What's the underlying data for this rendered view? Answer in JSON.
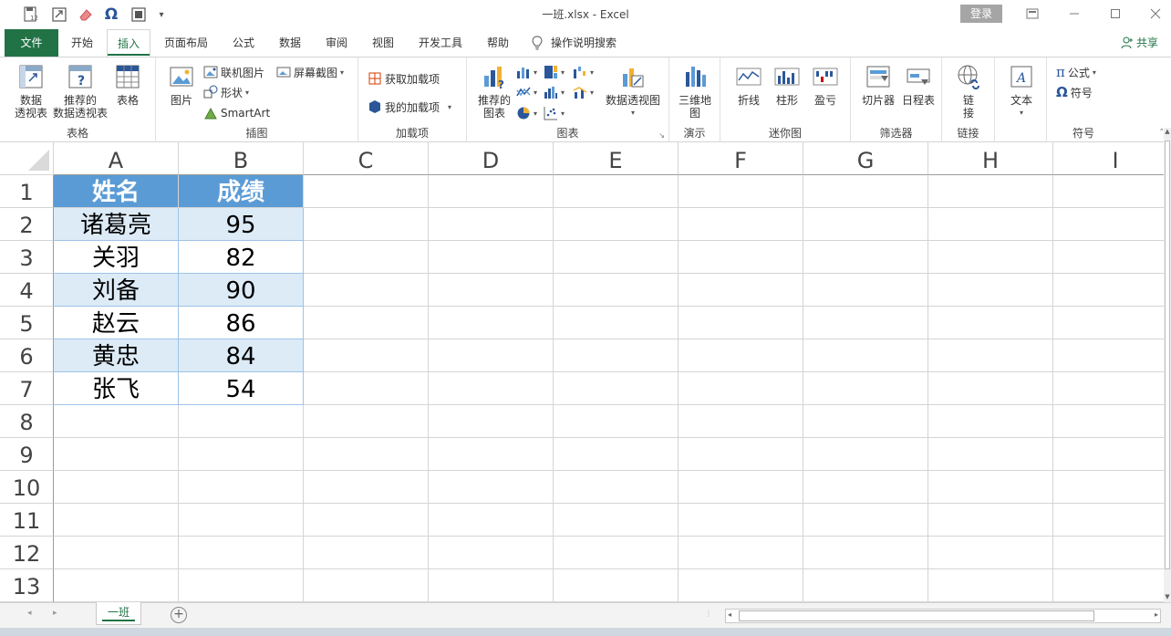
{
  "window": {
    "title": "一班.xlsx  -  Excel",
    "login_label": "登录"
  },
  "tabs": [
    {
      "label": "文件"
    },
    {
      "label": "开始"
    },
    {
      "label": "插入"
    },
    {
      "label": "页面布局"
    },
    {
      "label": "公式"
    },
    {
      "label": "数据"
    },
    {
      "label": "审阅"
    },
    {
      "label": "视图"
    },
    {
      "label": "开发工具"
    },
    {
      "label": "帮助"
    },
    {
      "label": "操作说明搜索"
    }
  ],
  "share_label": "共享",
  "ribbon": {
    "tables": {
      "label": "表格",
      "pivot": "数据\n透视表",
      "recommended_pivot": "推荐的\n数据透视表",
      "table": "表格"
    },
    "illustrations": {
      "label": "插图",
      "pictures": "图片",
      "online_pictures": "联机图片",
      "shapes": "形状",
      "smartart": "SmartArt",
      "screenshot": "屏幕截图"
    },
    "addins": {
      "label": "加载项",
      "get_addins": "获取加载项",
      "my_addins": "我的加载项"
    },
    "charts": {
      "label": "图表",
      "recommended": "推荐的\n图表",
      "pivot_chart": "数据透视图"
    },
    "tours": {
      "label": "演示",
      "map3d": "三维地\n图"
    },
    "sparklines": {
      "label": "迷你图",
      "line": "折线",
      "column": "柱形",
      "winloss": "盈亏"
    },
    "filters": {
      "label": "筛选器",
      "slicer": "切片器",
      "timeline": "日程表"
    },
    "links": {
      "label": "链接",
      "link": "链\n接"
    },
    "text": {
      "text": "文本"
    },
    "symbols": {
      "label": "符号",
      "equation": "公式",
      "symbol": "符号"
    }
  },
  "grid": {
    "columns": [
      "A",
      "B",
      "C",
      "D",
      "E",
      "F",
      "G",
      "H",
      "I"
    ],
    "rows": [
      "1",
      "2",
      "3",
      "4",
      "5",
      "6",
      "7",
      "8",
      "9",
      "10",
      "11",
      "12",
      "13"
    ],
    "header": [
      "姓名",
      "成绩"
    ],
    "records": [
      [
        "诸葛亮",
        "95"
      ],
      [
        "关羽",
        "82"
      ],
      [
        "刘备",
        "90"
      ],
      [
        "赵云",
        "86"
      ],
      [
        "黄忠",
        "84"
      ],
      [
        "张飞",
        "54"
      ]
    ]
  },
  "sheets": [
    {
      "label": "一班"
    }
  ],
  "colors": {
    "accent": "#217346",
    "table_header": "#5b9bd5",
    "table_band": "#ddebf7"
  }
}
